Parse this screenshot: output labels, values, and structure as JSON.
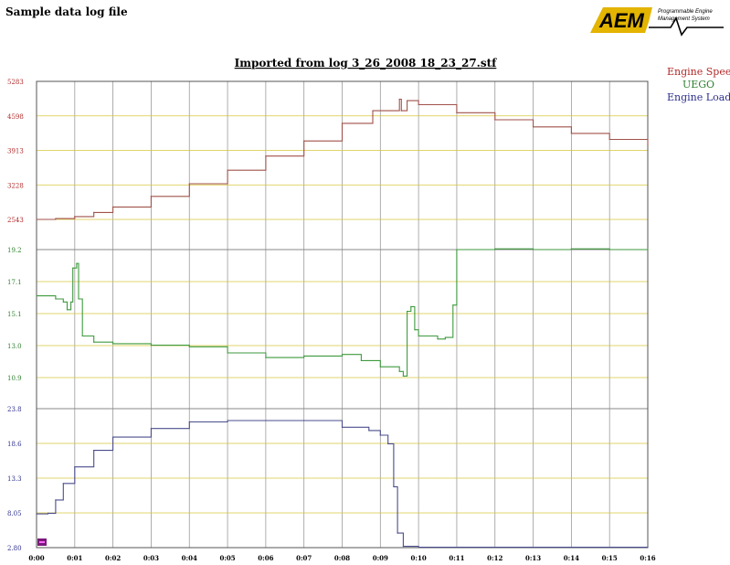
{
  "app": {
    "title": "Sample data log file"
  },
  "logo": {
    "text": "AEM",
    "line1": "Programmable Engine",
    "line2": "Management System"
  },
  "colors": {
    "engine_speed": "#a0524a",
    "uego": "#3f9a3f",
    "engine_load": "#4a4d8c",
    "gridline_horizontal": "#d6c63c",
    "gridline_vertical": "#9a9a9a",
    "axis_red": "#b02a2a",
    "axis_green": "#2f7f2f",
    "axis_blue": "#2d2f8c"
  },
  "chart_data": {
    "type": "line",
    "title": "Imported from log 3_26_2008 18_23_27.stf",
    "x_ticks": [
      "0:00",
      "0:01",
      "0:02",
      "0:03",
      "0:04",
      "0:05",
      "0:06",
      "0:07",
      "0:08",
      "0:09",
      "0:10",
      "0:11",
      "0:12",
      "0:13",
      "0:14",
      "0:15",
      "0:16"
    ],
    "x_range_seconds": [
      0,
      16
    ],
    "grid": true,
    "legend": [
      "Engine Speed",
      "UEGO",
      "Engine Load"
    ],
    "legend_position": "right",
    "panels": [
      {
        "series": "Engine Speed",
        "ticks": [
          "5283",
          "4598",
          "3913",
          "3228",
          "2543"
        ],
        "range": [
          2543,
          5283
        ],
        "points": [
          [
            0,
            2543
          ],
          [
            0.5,
            2560
          ],
          [
            1,
            2600
          ],
          [
            1.5,
            2680
          ],
          [
            2,
            2790
          ],
          [
            3,
            3000
          ],
          [
            4,
            3250
          ],
          [
            5,
            3520
          ],
          [
            6,
            3800
          ],
          [
            7,
            4100
          ],
          [
            8,
            4450
          ],
          [
            8.8,
            4700
          ],
          [
            9.5,
            4930
          ],
          [
            9.55,
            4700
          ],
          [
            9.7,
            4900
          ],
          [
            10,
            4820
          ],
          [
            11,
            4660
          ],
          [
            12,
            4520
          ],
          [
            13,
            4380
          ],
          [
            14,
            4250
          ],
          [
            15,
            4130
          ],
          [
            16,
            4020
          ]
        ]
      },
      {
        "series": "UEGO",
        "ticks": [
          "19.2",
          "17.1",
          "15.1",
          "13.0",
          "10.9"
        ],
        "range": [
          10.9,
          19.2
        ],
        "points": [
          [
            0,
            16.2
          ],
          [
            0.5,
            16.0
          ],
          [
            0.7,
            15.8
          ],
          [
            0.8,
            15.3
          ],
          [
            0.9,
            15.8
          ],
          [
            0.95,
            18.0
          ],
          [
            1.05,
            18.3
          ],
          [
            1.1,
            16.0
          ],
          [
            1.2,
            13.6
          ],
          [
            1.5,
            13.2
          ],
          [
            2,
            13.1
          ],
          [
            3,
            13.0
          ],
          [
            4,
            12.9
          ],
          [
            5,
            12.5
          ],
          [
            6,
            12.2
          ],
          [
            7,
            12.3
          ],
          [
            8,
            12.4
          ],
          [
            8.5,
            12.0
          ],
          [
            9,
            11.6
          ],
          [
            9.5,
            11.3
          ],
          [
            9.6,
            11.0
          ],
          [
            9.7,
            15.2
          ],
          [
            9.8,
            15.5
          ],
          [
            9.9,
            14.0
          ],
          [
            10,
            13.6
          ],
          [
            10.5,
            13.4
          ],
          [
            10.7,
            13.5
          ],
          [
            10.9,
            15.6
          ],
          [
            11,
            19.2
          ],
          [
            12,
            19.25
          ],
          [
            13,
            19.2
          ],
          [
            14,
            19.25
          ],
          [
            15,
            19.2
          ],
          [
            16,
            19.25
          ]
        ]
      },
      {
        "series": "Engine Load",
        "ticks": [
          "23.8",
          "18.6",
          "13.3",
          "8.05",
          "2.80"
        ],
        "range": [
          2.8,
          23.8
        ],
        "points": [
          [
            0,
            7.9
          ],
          [
            0.3,
            8.0
          ],
          [
            0.5,
            10.0
          ],
          [
            0.7,
            12.5
          ],
          [
            1,
            15.0
          ],
          [
            1.5,
            17.5
          ],
          [
            2,
            19.5
          ],
          [
            3,
            20.8
          ],
          [
            4,
            21.8
          ],
          [
            5,
            22.0
          ],
          [
            6,
            22.0
          ],
          [
            7,
            22.0
          ],
          [
            8,
            21.0
          ],
          [
            8.7,
            20.5
          ],
          [
            9,
            19.8
          ],
          [
            9.2,
            18.5
          ],
          [
            9.35,
            12.0
          ],
          [
            9.45,
            5.0
          ],
          [
            9.6,
            3.0
          ],
          [
            10,
            2.85
          ],
          [
            12,
            2.85
          ],
          [
            14,
            2.85
          ],
          [
            16,
            2.85
          ]
        ]
      }
    ]
  }
}
